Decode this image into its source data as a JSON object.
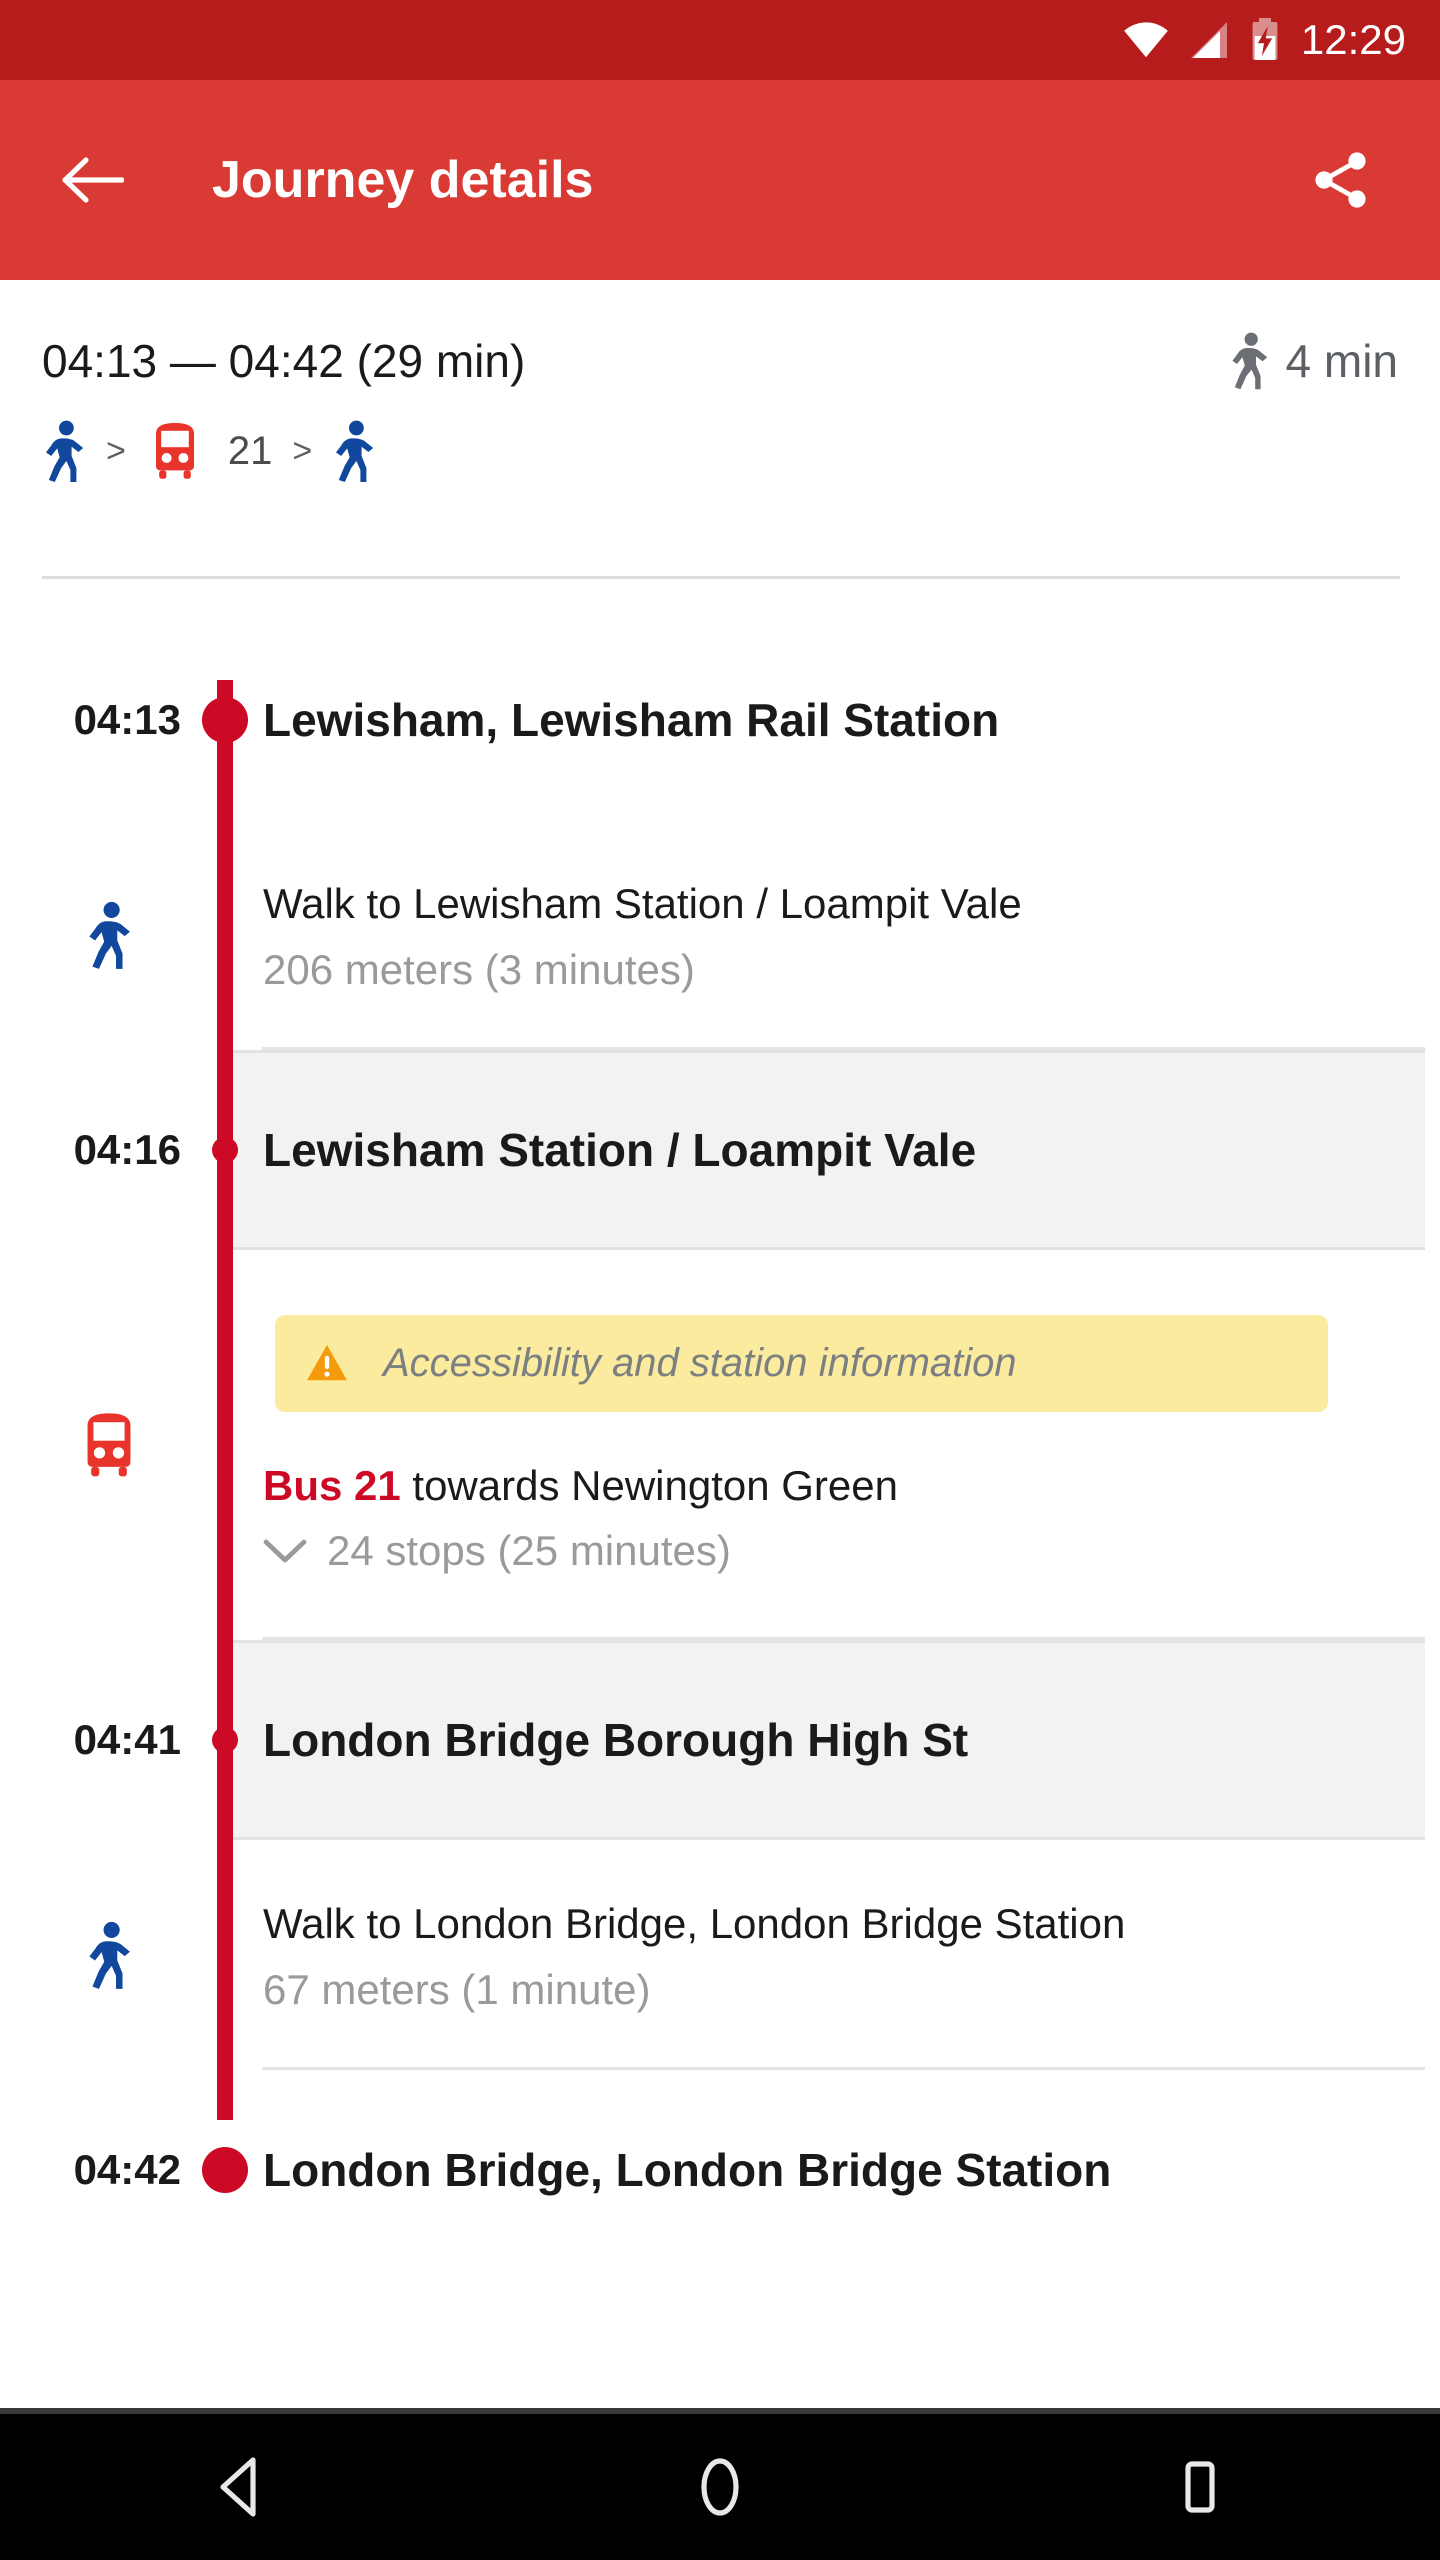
{
  "statusbar": {
    "time": "12:29",
    "icons": [
      "wifi-icon",
      "cellular-signal-icon",
      "battery-charging-icon"
    ]
  },
  "appbar": {
    "back_icon": "back-arrow-icon",
    "title": "Journey details",
    "share_icon": "share-icon"
  },
  "summary": {
    "times": "04:13 — 04:42  (29 min)",
    "walk_icon": "pedestrian-icon",
    "walk_total": "4 min",
    "mode_chain": {
      "walk_icon_1": "pedestrian-icon",
      "chevron_1": ">",
      "bus_icon": "bus-icon",
      "route": "21",
      "chevron_2": ">",
      "walk_icon_2": "pedestrian-icon"
    }
  },
  "timeline": [
    {
      "kind": "stop",
      "variant": "endpoint",
      "time": "04:13",
      "name": "Lewisham, Lewisham Rail Station"
    },
    {
      "kind": "segment",
      "icon": "pedestrian-icon",
      "title": "Walk to Lewisham Station / Loampit Vale",
      "subtitle": "206 meters (3 minutes)"
    },
    {
      "kind": "stop",
      "variant": "intermediate",
      "time": "04:16",
      "name": "Lewisham Station / Loampit Vale"
    },
    {
      "kind": "segment",
      "icon": "bus-icon",
      "banner": {
        "icon": "warning-triangle-icon",
        "text": "Accessibility and station information"
      },
      "title_prefix": "Bus 21",
      "title_rest": " towards Newington Green",
      "expand_icon": "chevron-down-icon",
      "subtitle": "24 stops (25 minutes)"
    },
    {
      "kind": "stop",
      "variant": "intermediate",
      "time": "04:41",
      "name": "London Bridge Borough High St"
    },
    {
      "kind": "segment",
      "icon": "pedestrian-icon",
      "title": "Walk to London Bridge, London Bridge Station",
      "subtitle": "67 meters (1 minute)"
    },
    {
      "kind": "stop",
      "variant": "endpoint",
      "time": "04:42",
      "name": "London Bridge, London Bridge Station"
    }
  ],
  "navbar": {
    "back": "nav-back-icon",
    "home": "nav-home-icon",
    "recents": "nav-recents-icon"
  },
  "colors": {
    "status_bar": "#b71c1c",
    "app_bar": "#d93a33",
    "timeline_red": "#cc0a26",
    "walk_blue": "#11489e",
    "bus_red": "#e8342a",
    "banner_yellow": "#fbeb9e",
    "warning_orange": "#f59b0b",
    "stop_row_grey": "#f2f2f2",
    "muted_text": "#9a9a9a"
  }
}
